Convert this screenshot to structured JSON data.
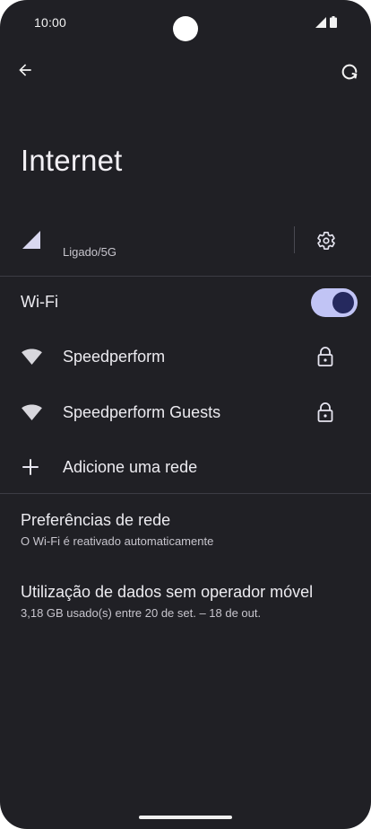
{
  "status_bar": {
    "time": "10:00"
  },
  "header": {
    "title": "Internet"
  },
  "mobile": {
    "status": "Ligado/5G"
  },
  "wifi": {
    "label": "Wi-Fi",
    "enabled": true
  },
  "networks": [
    {
      "name": "Speedperform",
      "locked": true
    },
    {
      "name": "Speedperform Guests",
      "locked": true
    }
  ],
  "add_network": {
    "label": "Adicione uma rede"
  },
  "preferences": [
    {
      "title": "Preferências de rede",
      "subtitle": "O Wi-Fi é reativado automaticamente"
    },
    {
      "title": "Utilização de dados sem operador móvel",
      "subtitle": "3,18 GB usado(s) entre 20 de set. – 18 de out."
    }
  ],
  "colors": {
    "background": "#202025",
    "toggle_track": "#c1c4f5",
    "toggle_knob": "#25295e"
  }
}
